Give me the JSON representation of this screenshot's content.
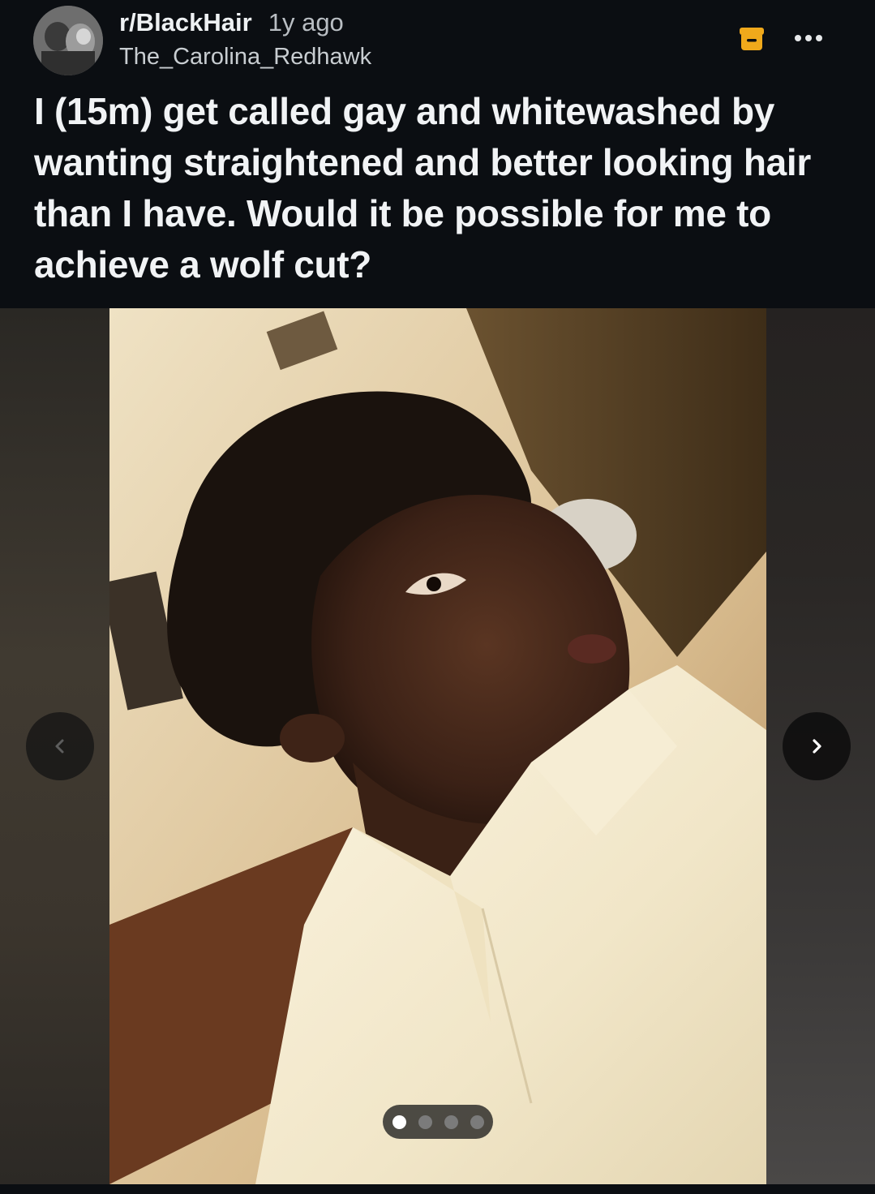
{
  "post": {
    "subreddit": "r/BlackHair",
    "age": "1y ago",
    "author": "The_Carolina_Redhawk",
    "title": "I (15m) get called gay and whitewashed by wanting straightened and better looking hair than I have. Would it be possible for me to achieve a wolf cut?"
  },
  "icons": {
    "archive": "archive-icon",
    "more": "more-options-icon",
    "prev": "chevron-left-icon",
    "next": "chevron-right-icon"
  },
  "gallery": {
    "image_count": 4,
    "current_index": 1
  },
  "colors": {
    "background": "#0b0e12",
    "archive_accent": "#f0a91b",
    "text": "#f1f3f5"
  }
}
